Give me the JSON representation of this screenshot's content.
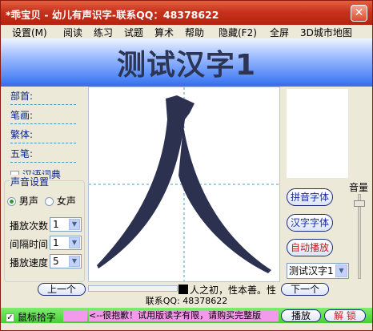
{
  "window": {
    "title": "*乖宝贝 - 幼儿有声识字-联系QQ：48378622",
    "close_label": "✕"
  },
  "menu": [
    {
      "label": "设置(M)"
    },
    {
      "label": "阅读"
    },
    {
      "label": "练习"
    },
    {
      "label": "试题"
    },
    {
      "label": "算术"
    },
    {
      "label": "帮助"
    },
    {
      "label": "隐藏(F2)"
    },
    {
      "label": "全屏"
    },
    {
      "label": "3D城市地图"
    }
  ],
  "header": {
    "title": "测试汉字1"
  },
  "info": {
    "radical_label": "部首:",
    "strokes_label": "笔画:",
    "traditional_label": "繁体:",
    "wubi_label": "五笔:",
    "dictionary_label": "汉语词典"
  },
  "voice_settings": {
    "legend": "声音设置",
    "male_label": "男声",
    "female_label": "女声",
    "male_selected": true,
    "play_count_label": "播放次数",
    "play_count_value": "1",
    "interval_label": "间隔时间",
    "interval_value": "1",
    "speed_label": "播放速度",
    "speed_value": "5"
  },
  "canvas": {
    "character": "人"
  },
  "right_panel": {
    "pinyin_font_label": "拼音字体",
    "hanzi_font_label": "汉字字体",
    "autoplay_label": "自动播放",
    "selected_set": "测试汉字1",
    "volume_label": "音量",
    "volume_level": 0.92
  },
  "navigation": {
    "prev_label": "上一个",
    "next_label": "下一个",
    "progress": 0.0,
    "scroll_text": "人之初，性本善。性"
  },
  "contact": {
    "text": "联系QQ: 48378622"
  },
  "bottom": {
    "mouse_pick_label": "鼠标拾字",
    "mouse_pick_checked": true,
    "marquee_text": "<--很抱歉！试用版读字有限，请购买完整版",
    "play_label": "播放",
    "unlock_label": "解 锁"
  },
  "colors": {
    "title_bar": "#c8321e",
    "header_blue": "#3d78f2",
    "bottom_green": "#45d033",
    "marquee_pink": "#f39aea",
    "character_fill": "#2c3150"
  },
  "icons": {
    "close": "close-icon",
    "dropdown": "chevron-down-icon"
  }
}
